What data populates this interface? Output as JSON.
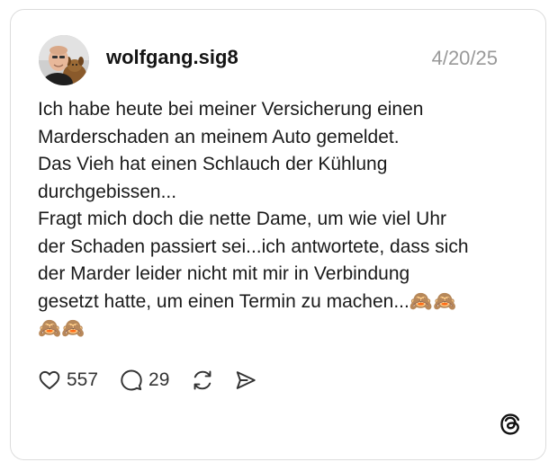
{
  "post": {
    "username": "wolfgang.sig8",
    "date": "4/20/25",
    "text_lines": [
      "Ich habe heute bei meiner Versicherung einen",
      "Marderschaden an meinem Auto gemeldet.",
      "Das Vieh hat einen Schlauch der Kühlung",
      "durchgebissen...",
      "Fragt mich doch die nette Dame, um wie viel Uhr",
      "der Schaden passiert sei...ich antwortete, dass sich",
      "der Marder leider nicht mit mir in Verbindung",
      "gesetzt hatte, um einen Termin zu machen...🙈🙈",
      "🙈🙈"
    ]
  },
  "actions": {
    "like_count": "557",
    "reply_count": "29"
  },
  "icons": {
    "like": "heart-icon",
    "reply": "comment-bubble-icon",
    "repost": "repost-arrows-icon",
    "share": "send-paper-plane-icon",
    "brand": "threads-logo-icon"
  },
  "colors": {
    "text": "#111111",
    "muted": "#999999",
    "border": "#dcdcdc"
  }
}
